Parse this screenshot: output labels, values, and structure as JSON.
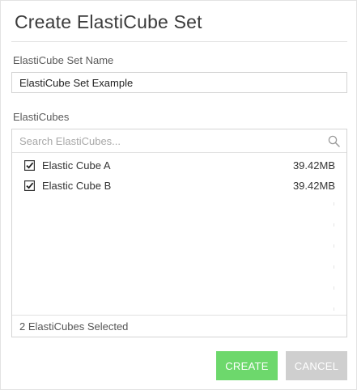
{
  "dialog": {
    "title": "Create ElastiCube Set"
  },
  "set_name": {
    "label": "ElastiCube Set Name",
    "value": "ElastiCube Set Example"
  },
  "cubes": {
    "label": "ElastiCubes",
    "search_placeholder": "Search ElastiCubes...",
    "items": [
      {
        "name": "Elastic Cube A",
        "size": "39.42MB",
        "checked": true
      },
      {
        "name": "Elastic Cube B",
        "size": "39.42MB",
        "checked": true
      }
    ],
    "selected_count_text": "2 ElastiCubes Selected"
  },
  "buttons": {
    "create": "CREATE",
    "cancel": "CANCEL"
  },
  "colors": {
    "create_bg": "#6dd86c",
    "cancel_bg": "#cfcfcf",
    "border": "#d4d4d4"
  }
}
